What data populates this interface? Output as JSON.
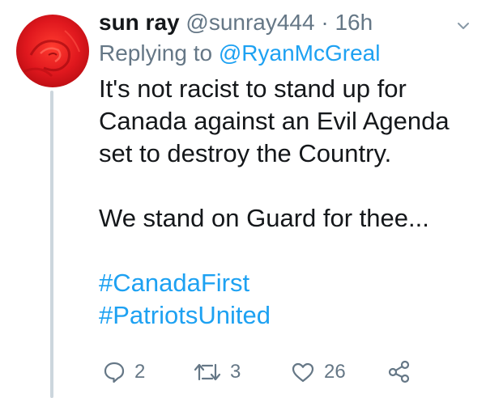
{
  "tweet": {
    "display_name": "sun ray",
    "handle": "@sunray444",
    "separator": "·",
    "time": "16h",
    "replying_prefix": "Replying to",
    "replying_to": "@RyanMcGreal",
    "lines": [
      "It's not racist to stand up for",
      "Canada  against an Evil Agenda",
      "set to destroy the Country."
    ],
    "line2": "We stand on Guard for thee...",
    "hashtags": [
      "#CanadaFirst",
      "#PatriotsUnited"
    ]
  },
  "actions": {
    "reply_count": "2",
    "retweet_count": "3",
    "like_count": "26"
  },
  "icons": {
    "reply": "reply-bubble-icon",
    "retweet": "retweet-icon",
    "like": "heart-icon",
    "share": "share-icon",
    "menu": "chevron-down-icon"
  },
  "colors": {
    "link": "#1da1f2",
    "muted": "#657786",
    "text": "#14171a",
    "thread_line": "#ccd6dd",
    "avatar_red": "#e0181e"
  }
}
